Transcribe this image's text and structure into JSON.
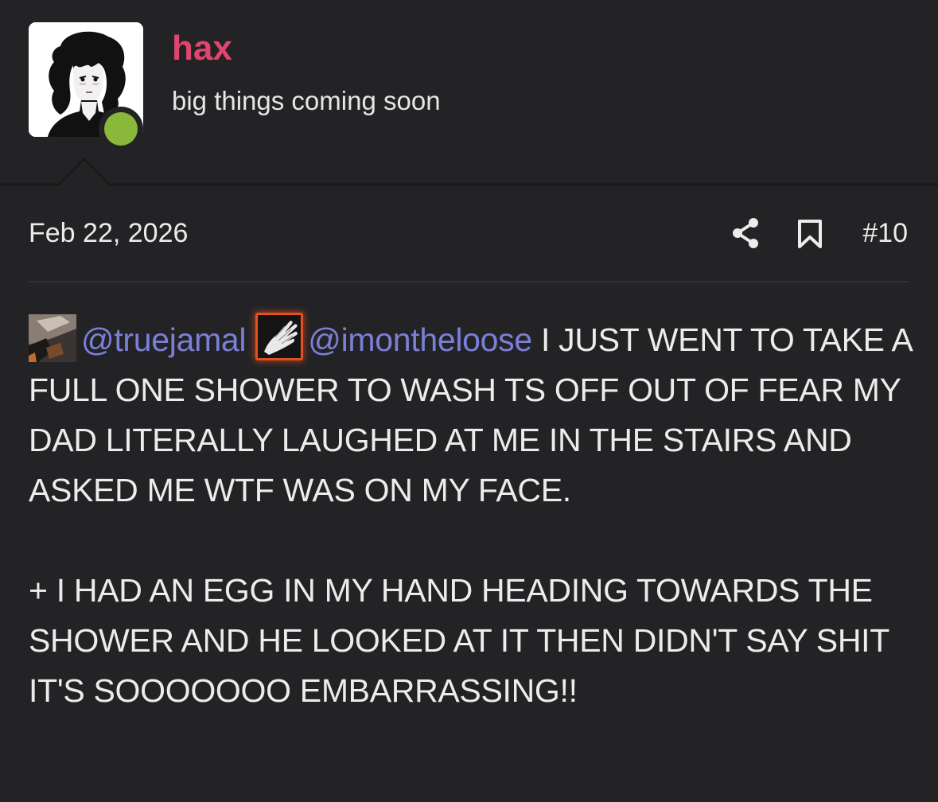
{
  "user": {
    "name": "hax",
    "title": "big things coming soon",
    "status": "online",
    "colors": {
      "name": "#e0456f",
      "online": "#8ab83a"
    }
  },
  "post": {
    "date": "Feb 22, 2026",
    "number": "#10",
    "actions": [
      "share-icon",
      "bookmark-icon"
    ],
    "mentions": [
      {
        "handle": "@truejamal"
      },
      {
        "handle": "@imontheloose"
      }
    ],
    "text_first": " I JUST WENT TO TAKE A FULL ONE SHOWER TO WASH TS OFF OUT OF FEAR MY DAD LITERALLY LAUGHED AT ME IN THE STAIRS AND ASKED ME WTF WAS ON MY FACE.",
    "text_second": "+ I HAD AN EGG IN MY HAND HEADING TOWARDS THE SHOWER AND HE LOOKED AT IT THEN DIDN'T SAY SHIT IT'S SOOOOOOO EMBARRASSING!!",
    "colors": {
      "mention": "#7a80d8",
      "avatar_frame": "#e4511e"
    }
  }
}
